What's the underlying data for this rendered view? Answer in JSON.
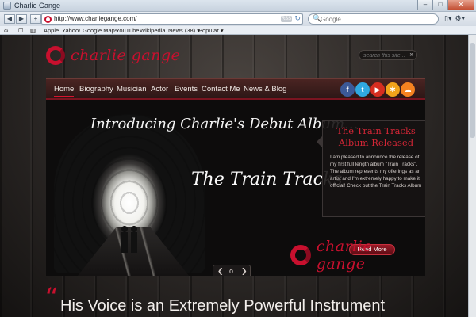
{
  "window": {
    "title": "Charlie Gange",
    "minimize": "–",
    "maximize": "□",
    "close": "✕"
  },
  "toolbar": {
    "back": "◀",
    "forward": "▶",
    "add": "+",
    "url": "http://www.charliegange.com/",
    "rss": "RSS",
    "reload": "↻",
    "search_placeholder": "Google",
    "search_glyph": "🔍",
    "page_menu": "▯▾",
    "tools_menu": "⚙▾"
  },
  "bookmarks": {
    "icons": [
      "∞",
      "☐",
      "▥"
    ],
    "items": [
      "Apple",
      "Yahoo!",
      "Google Maps",
      "YouTube",
      "Wikipedia",
      "News (38) ▾",
      "Popular ▾"
    ]
  },
  "site": {
    "logo_text": "charlie gange",
    "search_placeholder": "search this site...",
    "search_glyph": "»",
    "nav": [
      "Home",
      "Biography",
      "Musician",
      "Actor",
      "Events",
      "Contact Me",
      "News & Blog"
    ],
    "social": [
      {
        "label": "f",
        "color": "#3b5998",
        "name": "facebook-icon"
      },
      {
        "label": "t",
        "color": "#2fa8e0",
        "name": "twitter-icon"
      },
      {
        "label": "▶",
        "color": "#d62d20",
        "name": "youtube-icon"
      },
      {
        "label": "✱",
        "color": "#f2a31b",
        "name": "myspace-icon"
      },
      {
        "label": "☁",
        "color": "#f58220",
        "name": "soundcloud-icon"
      }
    ],
    "hero": {
      "title": "Introducing Charlie's Debut Album...",
      "album": "The Train Tracks",
      "promo_heading": "The Train Tracks Album Released",
      "promo_body": "I am pleased to announce the release of my first full length album \"Train Tracks\". The album represents my offerings as an artist and I'm extremely happy to make it official! Check out the Train Tracks Album",
      "read_more": "Read More",
      "logo_text": "charlie gange",
      "slider_prev": "❮",
      "slider_dot": "o",
      "slider_next": "❯"
    },
    "quote_mark": "“",
    "tagline": "His Voice is an Extremely Powerful Instrument"
  }
}
